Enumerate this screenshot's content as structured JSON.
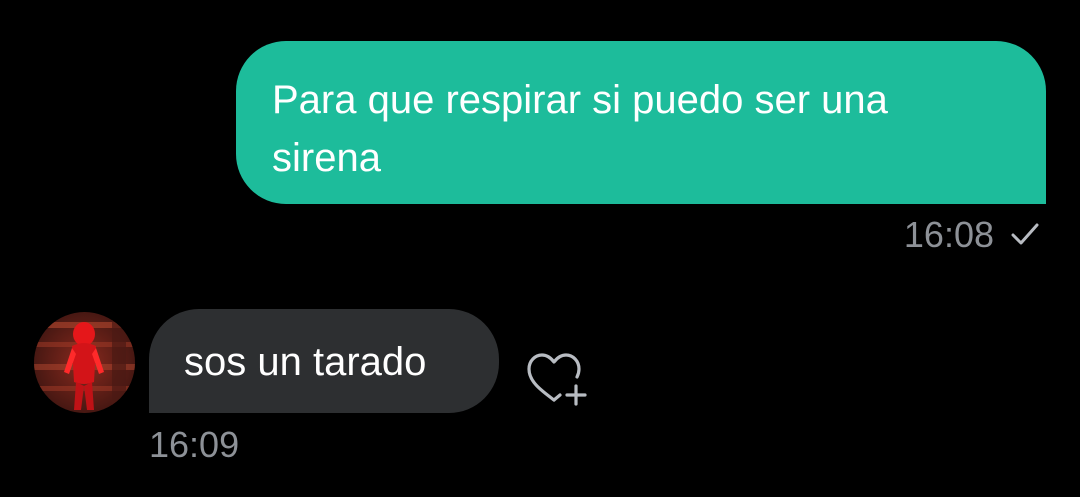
{
  "chat": {
    "sent_message": {
      "text": "Para que respirar si puedo ser una sirena",
      "time": "16:08",
      "status_icon": "check-icon"
    },
    "received_message": {
      "text": "sos un tarado",
      "time": "16:09",
      "reaction_icon": "heart-plus-icon"
    }
  },
  "colors": {
    "background": "#000000",
    "sent_bubble": "#1dbc9b",
    "received_bubble": "#2d2f31",
    "timestamp": "#8d9197",
    "message_text": "#ffffff"
  }
}
